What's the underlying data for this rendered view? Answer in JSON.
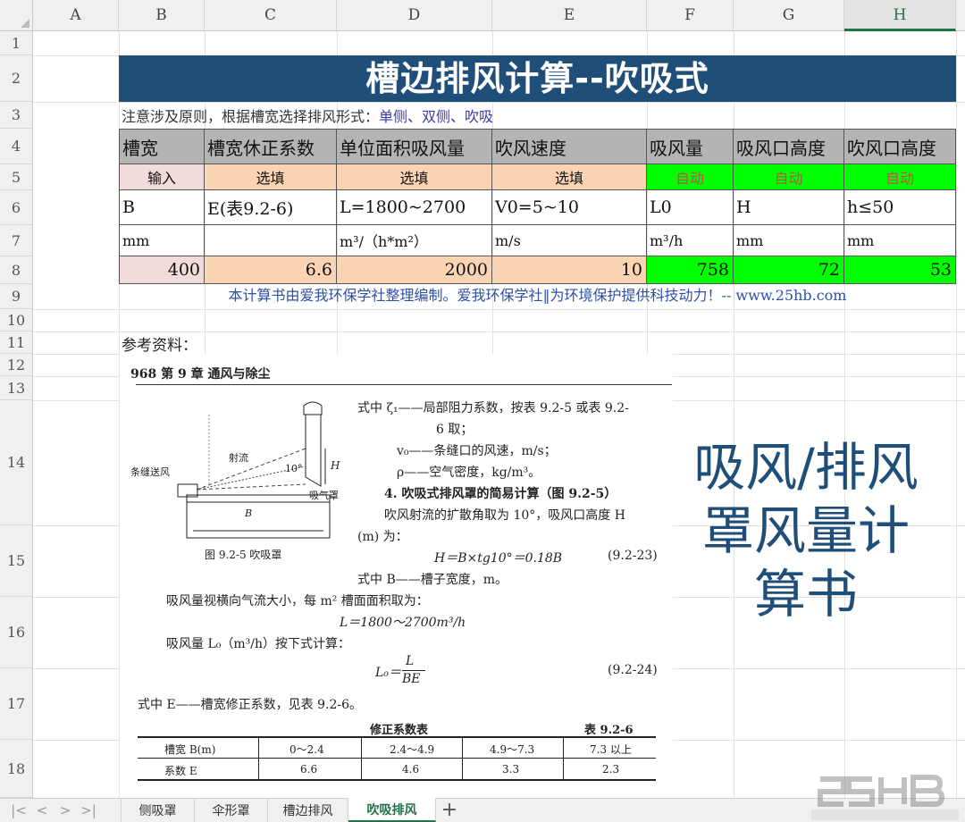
{
  "columns": [
    "A",
    "B",
    "C",
    "D",
    "E",
    "F",
    "G",
    "H"
  ],
  "rows": [
    "1",
    "2",
    "3",
    "4",
    "5",
    "6",
    "7",
    "8",
    "9",
    "10",
    "11",
    "12",
    "13",
    "14",
    "15",
    "16",
    "17",
    "18"
  ],
  "title": "槽边排风计算--吹吸式",
  "note": {
    "prefix": "注意涉及原则，根据槽宽选择排风形式：",
    "options": "单侧、双侧、吹吸"
  },
  "table": {
    "headers": [
      "槽宽",
      "槽宽休正系数",
      "单位面积吸风量",
      "吹风速度",
      "吸风量",
      "吸风口高度",
      "吹风口高度"
    ],
    "modes": [
      "输入",
      "选填",
      "选填",
      "选填",
      "自动",
      "自动",
      "自动"
    ],
    "symbols": [
      "B",
      "E(表9.2-6)",
      "L=1800~2700",
      "V0=5~10",
      "L0",
      "H",
      "h≤50"
    ],
    "units": [
      "mm",
      "",
      "m³/（h*m²）",
      "m/s",
      "m³/h",
      "mm",
      "mm"
    ],
    "values": [
      "400",
      "6.6",
      "2000",
      "10",
      "758",
      "72",
      "53"
    ]
  },
  "credit": "本计算书由爱我环保学社整理编制。爱我环保学社‖为环境保护提供科技动力！-- www.25hb.com",
  "references_label": "参考资料：",
  "reference": {
    "page_header": "968  第 9 章  通风与除尘",
    "fig_label_blow": "条缝送风",
    "fig_label_jet": "射流",
    "fig_label_angle": "10°",
    "fig_label_hood": "吸气罩",
    "fig_label_H": "H",
    "fig_label_B": "B",
    "fig_caption": "图 9.2-5   吹吸罩",
    "l1": "式中  ζ₁——局部阻力系数，按表 9.2-5 或表 9.2-",
    "l2": "6 取；",
    "l3": "v₀——条缝口的风速，m/s；",
    "l4": "ρ——空气密度，kg/m³。",
    "l5": "4. 吹吸式排风罩的简易计算（图 9.2-5）",
    "l6": "吹风射流的扩散角取为 10°，吸风口高度 H",
    "l7": "(m) 为：",
    "eq1": "H＝B×tg10°＝0.18B",
    "eq1_no": "(9.2-23)",
    "l8": "式中  B——槽子宽度，m。",
    "l9": "吸风量视横向气流大小，每 m² 槽面面积取为：",
    "eq2": "L＝1800～2700m³/h",
    "l10": "吸风量 L₀（m³/h）按下式计算：",
    "eq3_lhs": "L₀＝",
    "eq3_num": "L",
    "eq3_den": "BE",
    "eq3_no": "(9.2-24)",
    "l11": "式中  E——槽宽修正系数，见表 9.2-6。",
    "tbl_title": "修正系数表",
    "tbl_no": "表 9.2-6",
    "tbl_row1": [
      "槽宽 B(m)",
      "0～2.4",
      "2.4～4.9",
      "4.9～7.3",
      "7.3 以上"
    ],
    "tbl_row2": [
      "系数 E",
      "6.6",
      "4.6",
      "3.3",
      "2.3"
    ]
  },
  "big_text": [
    "吸风/排风",
    "罩风量计",
    "算书"
  ],
  "sheet_tabs": [
    "侧吸罩",
    "伞形罩",
    "槽边排风",
    "吹吸排风"
  ],
  "active_tab": "吹吸排风",
  "add_tab": "+",
  "nav_icons": [
    "|<",
    "<",
    ">",
    ">|"
  ],
  "colors": {
    "title_bg": "#1f4e79",
    "header_gray": "#b4b4b4",
    "input_pink": "#f2dcdb",
    "optional_peach": "#fbd4b4",
    "auto_green": "#00ff00",
    "accent": "#217346"
  }
}
